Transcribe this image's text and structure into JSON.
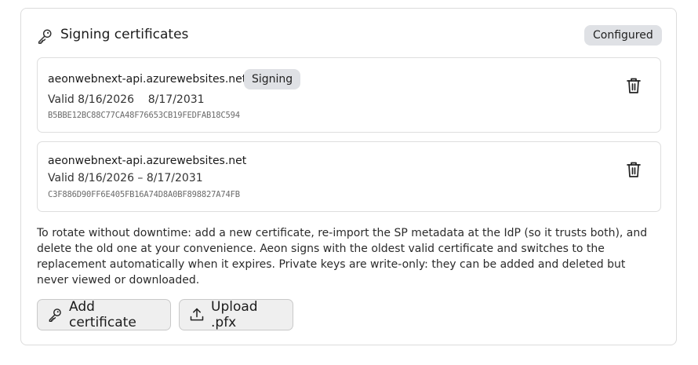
{
  "section": {
    "title": "Signing certificates",
    "status": "Configured",
    "header_icon": "key-icon"
  },
  "certificates": [
    {
      "name": "aeonwebnext-api.azurewebsites.net",
      "badge": "Signing",
      "validity": "Valid 8/16/2026    8/17/2031",
      "thumbprint": "B5BBE12BC88C77CA48F76653CB19FEDFAB18C594",
      "delete_icon": "trash-icon"
    },
    {
      "name": "aeonwebnext-api.azurewebsites.net",
      "validity": "Valid 8/16/2026 – 8/17/2031",
      "thumbprint": "C3F886D90FF6E405FB16A74D8A0BF898827A74FB",
      "delete_icon": "trash-icon"
    }
  ],
  "help_text": "To rotate without downtime: add a new certificate, re-import the SP metadata at the IdP (so it trusts both), and delete the old one at your convenience. Aeon signs with the oldest valid certificate and switches to the replacement automatically when it expires. Private keys are write-only: they can be added and deleted but never viewed or downloaded.",
  "actions": {
    "add_label": "Add certificate",
    "add_icon": "key-icon",
    "upload_label": "Upload .pfx",
    "upload_icon": "upload-icon"
  }
}
